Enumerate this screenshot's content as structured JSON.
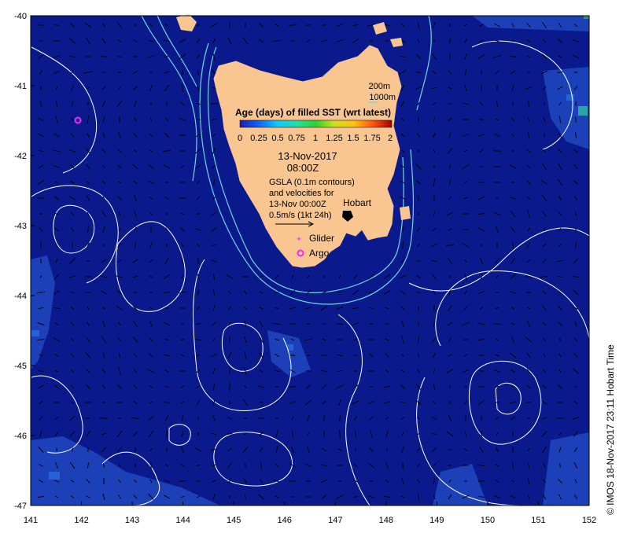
{
  "map": {
    "lon_ticks": [
      "141",
      "142",
      "143",
      "144",
      "145",
      "146",
      "147",
      "148",
      "149",
      "150",
      "151",
      "152"
    ],
    "lat_ticks": [
      "-40",
      "-41",
      "-42",
      "-43",
      "-44",
      "-45",
      "-46",
      "-47"
    ],
    "lon_range": [
      141,
      152
    ],
    "lat_range": [
      -47,
      -40
    ],
    "colors": {
      "ocean": "#0a1a8c",
      "ocean_mid": "#0c2aa8",
      "ocean_light": "#1f55d0",
      "land": "#f9c591",
      "contour": "#ffffff",
      "bathy": "#74d4e4",
      "glider": "#ff44ff",
      "argo": "#ff22ff",
      "arrow": "#000000"
    }
  },
  "legend": {
    "title": "Age (days) of filled SST (wrt latest)",
    "scale_labels": [
      "0",
      "0.25",
      "0.5",
      "0.75",
      "1",
      "1.25",
      "1.5",
      "1.75",
      "2"
    ]
  },
  "annotations": {
    "depth_200": "200m",
    "depth_1000": "1000m",
    "date": "13-Nov-2017",
    "time": "08:00Z",
    "gsla_line1": "GSLA (0.1m contours)",
    "gsla_line2": "and velocities for",
    "gsla_line3": "13-Nov 00:00Z",
    "hobart": "Hobart",
    "velocity_scale": "0.5m/s (1kt 24h)",
    "glider": "Glider",
    "argo": "Argo"
  },
  "credit": "© IMOS 18-Nov-2017 23:11 Hobart Time"
}
